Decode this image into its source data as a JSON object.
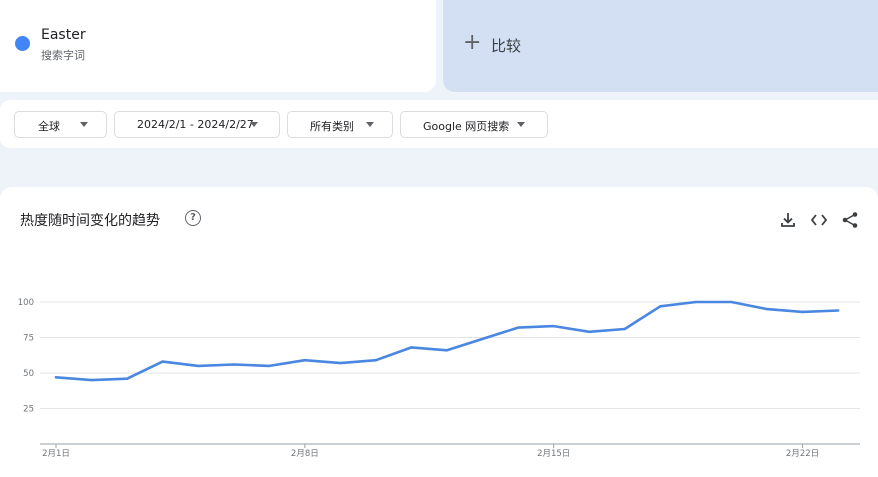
{
  "term": {
    "name": "Easter",
    "subtitle": "搜索字词",
    "color": "#4285f4"
  },
  "compare": {
    "plus": "+",
    "label": "比较"
  },
  "filters": {
    "region": "全球",
    "date_range": "2024/2/1 - 2024/2/27",
    "category": "所有类别",
    "search_type": "Google 网页搜索"
  },
  "chart_section": {
    "title": "热度随时间变化的趋势",
    "help_symbol": "?",
    "icons": [
      "download-icon",
      "embed-code-icon",
      "share-icon"
    ]
  },
  "chart_data": {
    "type": "line",
    "x_tick_labels": [
      "2月1日",
      "2月8日",
      "2月15日",
      "2月22日"
    ],
    "x_tick_day_index": [
      0,
      7,
      14,
      21
    ],
    "y_ticks": [
      25,
      50,
      75,
      100
    ],
    "ylim": [
      0,
      100
    ],
    "grid": true,
    "series": [
      {
        "color": "#4a87e0",
        "x": [
          "2024-02-01",
          "2024-02-02",
          "2024-02-03",
          "2024-02-04",
          "2024-02-05",
          "2024-02-06",
          "2024-02-07",
          "2024-02-08",
          "2024-02-09",
          "2024-02-10",
          "2024-02-11",
          "2024-02-12",
          "2024-02-13",
          "2024-02-14",
          "2024-02-15",
          "2024-02-16",
          "2024-02-17",
          "2024-02-18",
          "2024-02-19",
          "2024-02-20",
          "2024-02-21",
          "2024-02-22",
          "2024-02-23"
        ],
        "values": [
          47,
          45,
          46,
          58,
          55,
          56,
          55,
          59,
          57,
          59,
          68,
          66,
          74,
          82,
          83,
          79,
          81,
          97,
          100,
          100,
          95,
          93,
          94
        ]
      }
    ]
  }
}
